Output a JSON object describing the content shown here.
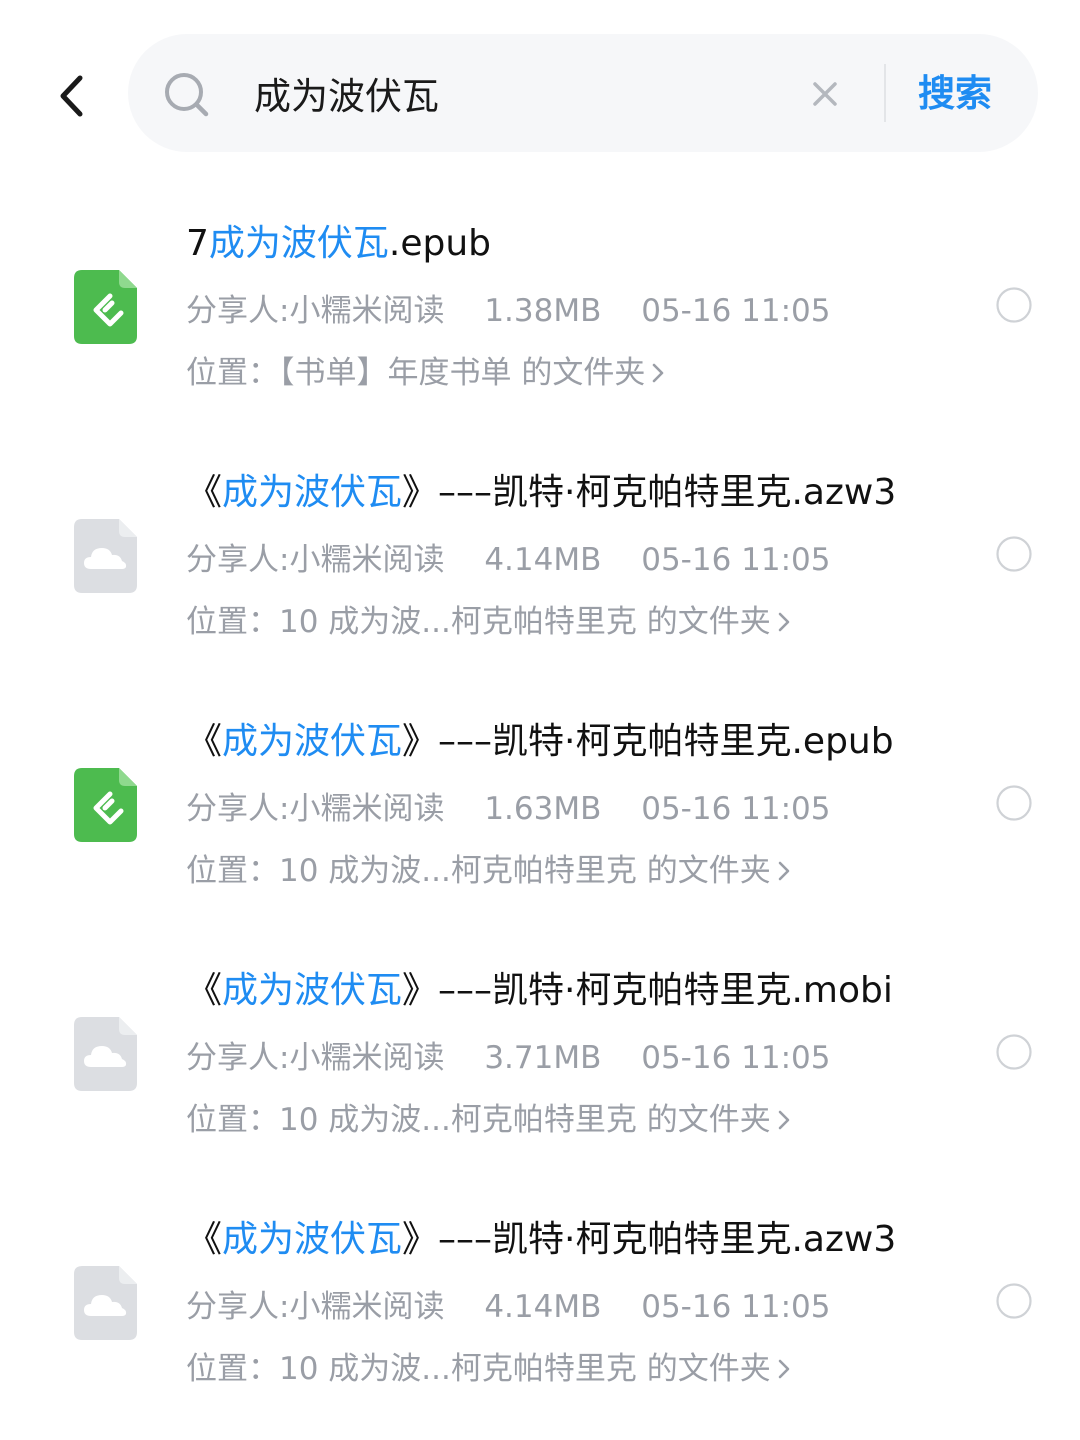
{
  "header": {
    "back_icon": "chevron-left-icon",
    "search": {
      "value": "成为波伏瓦",
      "placeholder": "",
      "search_icon": "search-icon",
      "clear_icon": "close-icon",
      "button_label": "搜索"
    }
  },
  "colors": {
    "accent": "#1f8cf2",
    "meta_text": "#9a9ea6",
    "epub_icon": "#4dbb4f",
    "generic_icon": "#dcdee2"
  },
  "results": [
    {
      "icon": "epub-file-icon",
      "title_prefix": "7",
      "title_highlight": "成为波伏瓦",
      "title_suffix": ".epub",
      "sharer": "分享人:小糯米阅读",
      "size": "1.38MB",
      "time": "05-16 11:05",
      "location": "位置：【书单】年度书单 的文件夹"
    },
    {
      "icon": "cloud-file-icon",
      "title_prefix": "《",
      "title_highlight": "成为波伏瓦",
      "title_suffix": "》–––凯特·柯克帕特里克.azw3",
      "sharer": "分享人:小糯米阅读",
      "size": "4.14MB",
      "time": "05-16 11:05",
      "location": "位置：10 成为波...柯克帕特里克 的文件夹"
    },
    {
      "icon": "epub-file-icon",
      "title_prefix": "《",
      "title_highlight": "成为波伏瓦",
      "title_suffix": "》–––凯特·柯克帕特里克.epub",
      "sharer": "分享人:小糯米阅读",
      "size": "1.63MB",
      "time": "05-16 11:05",
      "location": "位置：10 成为波...柯克帕特里克 的文件夹"
    },
    {
      "icon": "cloud-file-icon",
      "title_prefix": "《",
      "title_highlight": "成为波伏瓦",
      "title_suffix": "》–––凯特·柯克帕特里克.mobi",
      "sharer": "分享人:小糯米阅读",
      "size": "3.71MB",
      "time": "05-16 11:05",
      "location": "位置：10 成为波...柯克帕特里克 的文件夹"
    },
    {
      "icon": "cloud-file-icon",
      "title_prefix": "《",
      "title_highlight": "成为波伏瓦",
      "title_suffix": "》–––凯特·柯克帕特里克.azw3",
      "sharer": "分享人:小糯米阅读",
      "size": "4.14MB",
      "time": "05-16 11:05",
      "location": "位置：10 成为波...柯克帕特里克 的文件夹"
    }
  ]
}
